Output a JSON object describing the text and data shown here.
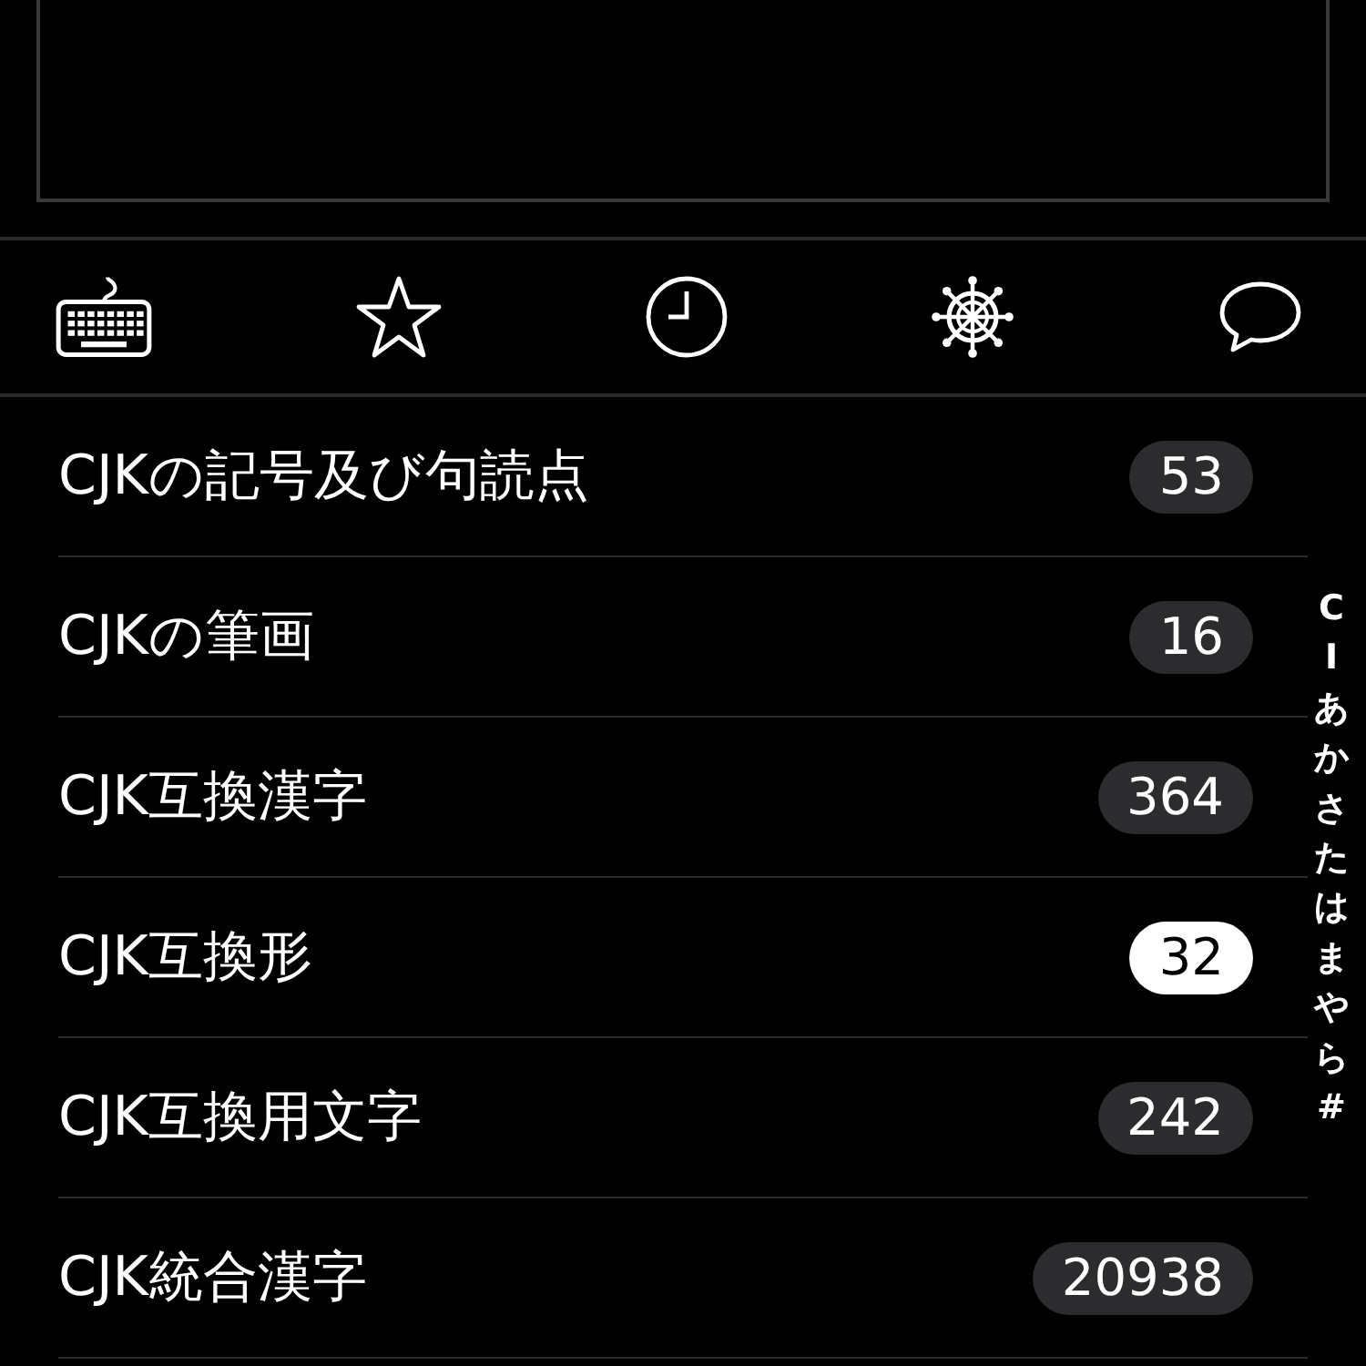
{
  "text_area": {
    "kind": "empty"
  },
  "toolbar": [
    {
      "kind": "keyboard"
    },
    {
      "kind": "star"
    },
    {
      "kind": "clock"
    },
    {
      "kind": "wheel"
    },
    {
      "kind": "bubble"
    }
  ],
  "rows": [
    {
      "label": "CJKの記号及び句読点",
      "count": "53",
      "selected": false
    },
    {
      "label": "CJKの筆画",
      "count": "16",
      "selected": false
    },
    {
      "label": "CJK互換漢字",
      "count": "364",
      "selected": false
    },
    {
      "label": "CJK互換形",
      "count": "32",
      "selected": true
    },
    {
      "label": "CJK互換用文字",
      "count": "242",
      "selected": false
    },
    {
      "label": "CJK統合漢字",
      "count": "20938",
      "selected": false
    }
  ],
  "index": [
    "C",
    "I",
    "あ",
    "か",
    "さ",
    "た",
    "は",
    "ま",
    "や",
    "ら",
    "#"
  ]
}
